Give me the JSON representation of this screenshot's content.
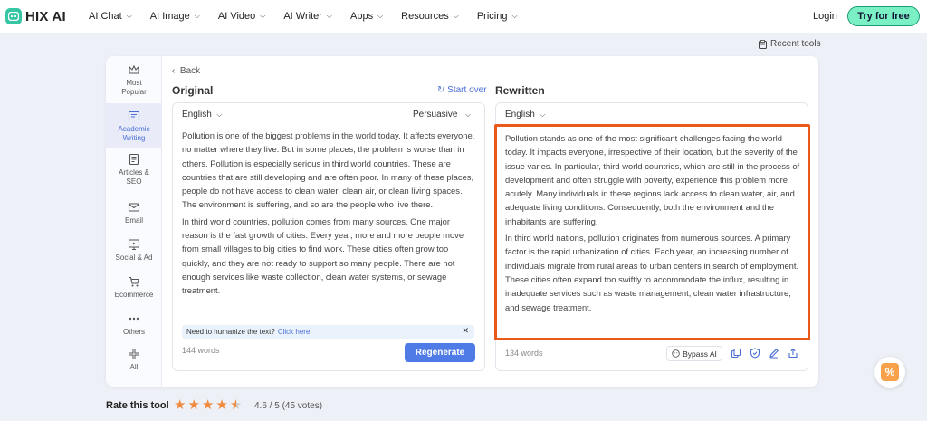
{
  "header": {
    "logo_text": "HIX AI",
    "nav": [
      {
        "label": "AI Chat"
      },
      {
        "label": "AI Image"
      },
      {
        "label": "AI Video"
      },
      {
        "label": "AI Writer"
      },
      {
        "label": "Apps"
      },
      {
        "label": "Resources"
      },
      {
        "label": "Pricing"
      }
    ],
    "login": "Login",
    "cta": "Try for free"
  },
  "recent_tools": "Recent tools",
  "sidebar": {
    "items": [
      {
        "label_1": "Most",
        "label_2": "Popular",
        "icon": "crown-icon"
      },
      {
        "label_1": "Academic",
        "label_2": "Writing",
        "icon": "academic-icon"
      },
      {
        "label_1": "Articles &",
        "label_2": "SEO",
        "icon": "articles-icon"
      },
      {
        "label_1": "Email",
        "label_2": "",
        "icon": "mail-icon"
      },
      {
        "label_1": "Social & Ad",
        "label_2": "",
        "icon": "social-icon"
      },
      {
        "label_1": "Ecommerce",
        "label_2": "",
        "icon": "cart-icon"
      },
      {
        "label_1": "Others",
        "label_2": "",
        "icon": "more-icon"
      },
      {
        "label_1": "All",
        "label_2": "",
        "icon": "grid-icon"
      }
    ],
    "active_index": 1
  },
  "editor": {
    "back": "Back",
    "original_title": "Original",
    "start_over": "Start over",
    "rewritten_title": "Rewritten",
    "original": {
      "language": "English",
      "tone": "Persuasive",
      "paragraphs": [
        "Pollution is one of the biggest problems in the world today. It affects everyone, no matter where they live. But in some places, the problem is worse than in others. Pollution is especially serious in third world countries. These are countries that are still developing and are often poor. In many of these places, people do not have access to clean water, clean air, or clean living spaces. The environment is suffering, and so are the people who live there.",
        "In third world countries, pollution comes from many sources. One major reason is the fast growth of cities. Every year, more and more people move from small villages to big cities to find work. These cities often grow too quickly, and they are not ready to support so many people. There are not enough services like waste collection, clean water systems, or sewage treatment."
      ],
      "humanize_text": "Need to humanize the text?",
      "humanize_link": "Click here",
      "word_count": "144 words",
      "regenerate": "Regenerate"
    },
    "rewritten": {
      "language": "English",
      "paragraphs": [
        "Pollution stands as one of the most significant challenges facing the world today. It impacts everyone, irrespective of their location, but the severity of the issue varies. In particular, third world countries, which are still in the process of development and often struggle with poverty, experience this problem more acutely. Many individuals in these regions lack access to clean water, air, and adequate living conditions. Consequently, both the environment and the inhabitants are suffering.",
        "In third world nations, pollution originates from numerous sources. A primary factor is the rapid urbanization of cities. Each year, an increasing number of individuals migrate from rural areas to urban centers in search of employment. These cities often expand too swiftly to accommodate the influx, resulting in inadequate services such as waste management, clean water infrastructure, and sewage treatment."
      ],
      "word_count": "134 words",
      "bypass": "Bypass AI"
    }
  },
  "rating": {
    "label": "Rate this tool",
    "score": 4.6,
    "text": "4.6 / 5 (45 votes)"
  },
  "colors": {
    "accent": "#4f7be6",
    "highlight": "#e8591a",
    "star": "#f08a3c",
    "cta": "#7af0c4"
  }
}
